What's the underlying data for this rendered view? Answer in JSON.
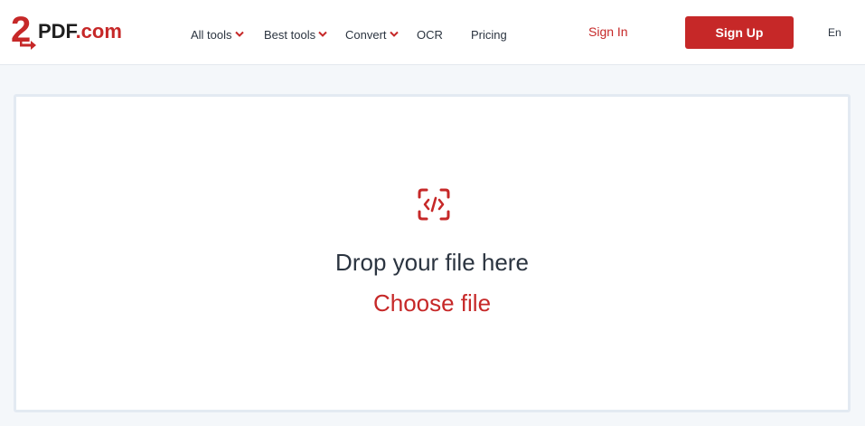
{
  "logo": {
    "digit": "2",
    "name": "PDF",
    "tld": ".com"
  },
  "nav": {
    "items": [
      {
        "label": "All tools",
        "has_dropdown": true
      },
      {
        "label": "Best tools",
        "has_dropdown": true
      },
      {
        "label": "Convert",
        "has_dropdown": true
      },
      {
        "label": "OCR",
        "has_dropdown": false
      },
      {
        "label": "Pricing",
        "has_dropdown": false
      }
    ]
  },
  "auth": {
    "signin_label": "Sign In",
    "signup_label": "Sign Up"
  },
  "language": "En",
  "dropzone": {
    "icon": "code-file-icon",
    "title": "Drop your file here",
    "choose_label": "Choose file"
  },
  "colors": {
    "brand": "#c62828",
    "text": "#2b3440",
    "background": "#f4f7fa"
  }
}
